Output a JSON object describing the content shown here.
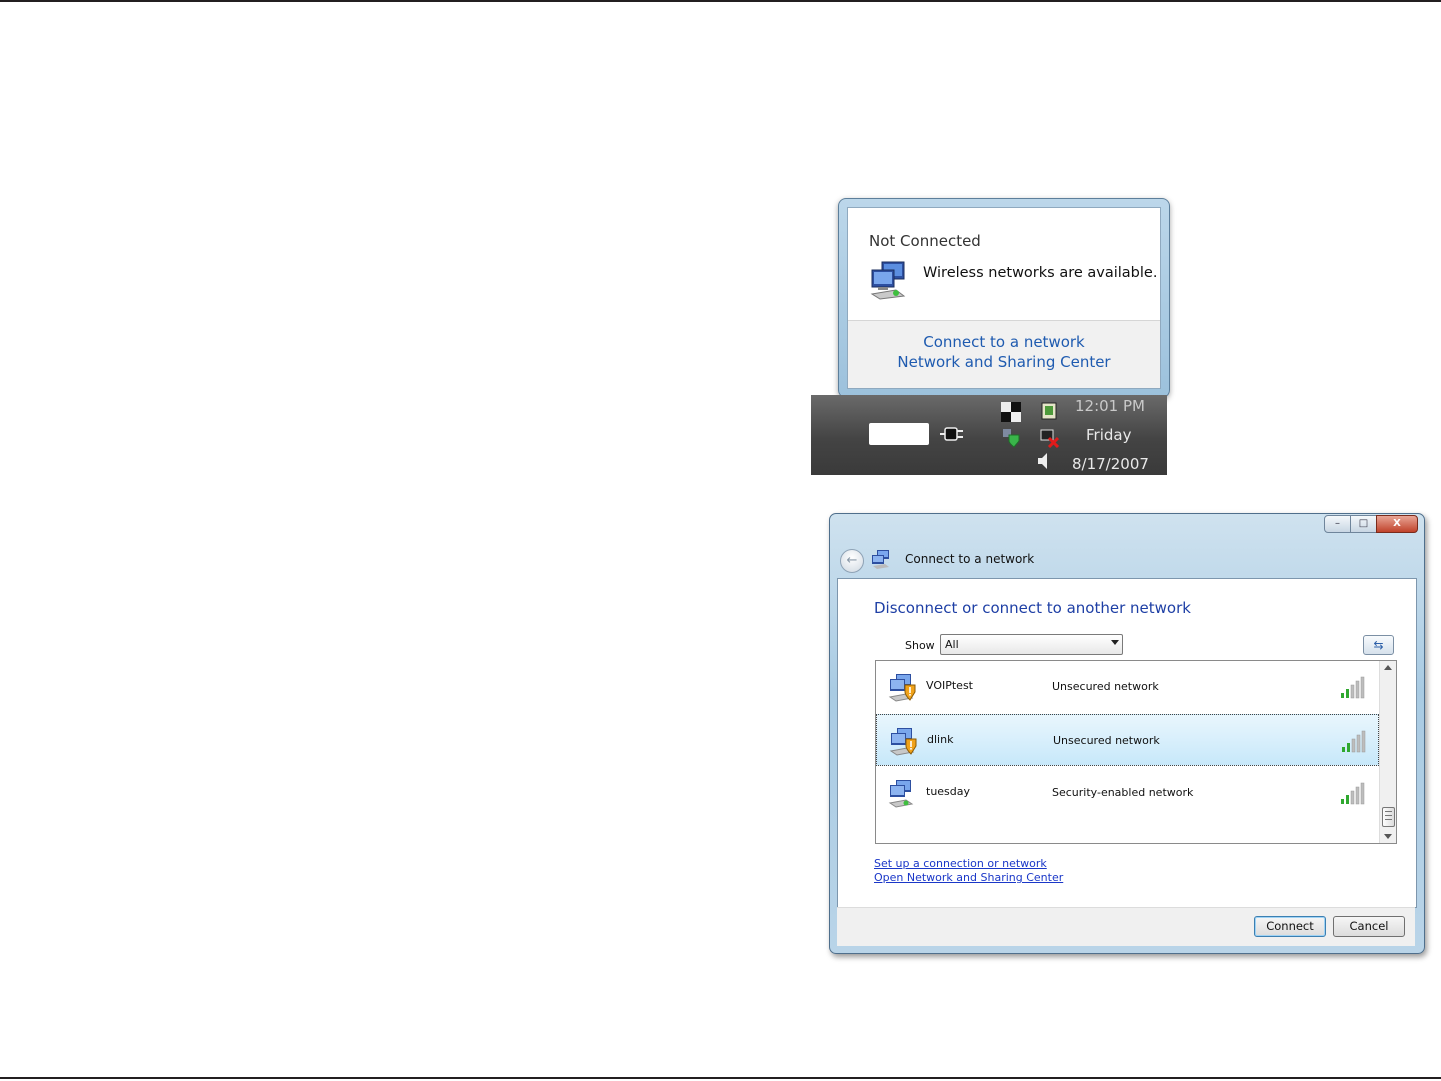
{
  "balloon": {
    "title": "Not Connected",
    "message": "Wireless networks are available.",
    "links": [
      "Connect to a network",
      "Network and Sharing Center"
    ]
  },
  "taskbar": {
    "time": "12:01 PM",
    "day": "Friday",
    "date": "8/17/2007"
  },
  "dialog": {
    "window_title": "Connect to a network",
    "window_controls": [
      "–",
      "□",
      "X"
    ],
    "heading": "Disconnect or connect to another network",
    "show_label": "Show",
    "show_value": "All",
    "networks": [
      {
        "name": "VOIPtest",
        "security": "Unsecured network",
        "selected": false
      },
      {
        "name": "dlink",
        "security": "Unsecured network",
        "selected": true
      },
      {
        "name": "tuesday",
        "security": "Security-enabled network",
        "selected": false
      }
    ],
    "links": [
      "Set up a connection or network",
      "Open Network and Sharing Center"
    ],
    "buttons": {
      "connect": "Connect",
      "cancel": "Cancel"
    }
  },
  "colors": {
    "link": "#1a37c8",
    "heading": "#1e3fa5",
    "balloon_link": "#1f5bb0"
  },
  "icons": [
    "network-icon",
    "shield-warning-icon",
    "signal-bars-icon",
    "back-arrow-icon",
    "refresh-icon",
    "power-plug-icon",
    "speaker-icon",
    "security-center-icon",
    "network-disconnected-icon"
  ]
}
